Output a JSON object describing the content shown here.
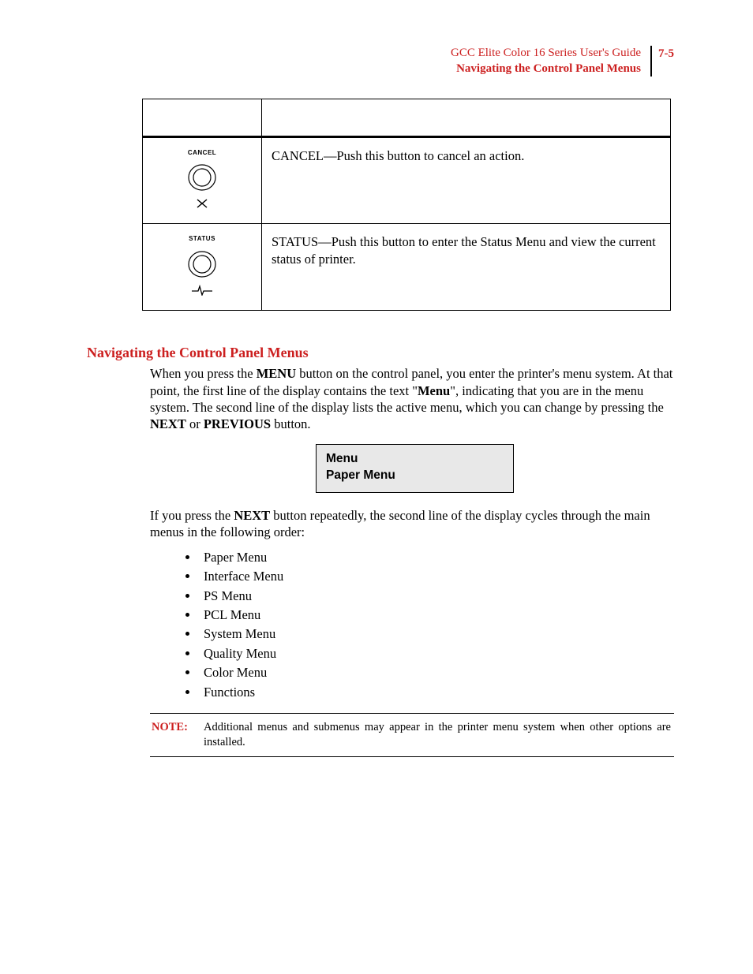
{
  "header": {
    "guide_title": "GCC Elite Color 16 Series User's Guide",
    "section_name": "Navigating the Control Panel Menus",
    "page_number": "7-5"
  },
  "button_table": {
    "rows": [
      {
        "label": "CANCEL",
        "icon": "x",
        "description": "CANCEL—Push this button to cancel an action."
      },
      {
        "label": "STATUS",
        "icon": "pulse",
        "description": "STATUS—Push this button to enter the Status Menu and view the current status of printer."
      }
    ]
  },
  "section": {
    "title": "Navigating the Control Panel Menus",
    "para1_pre": "When you press the ",
    "para1_b1": "MENU",
    "para1_mid1": " button on the control panel, you enter the printer's menu system. At that point, the first line of the display contains the text \"",
    "para1_b2": "Menu",
    "para1_mid2": "\", indicating that you are in the menu system. The second line of the display lists the active menu, which you can change by pressing the ",
    "para1_b3": "NEXT",
    "para1_mid3": " or ",
    "para1_b4": "PREVIOUS",
    "para1_post": " button.",
    "lcd": {
      "line1": "Menu",
      "line2": "Paper Menu"
    },
    "para2_pre": "If you press the ",
    "para2_b1": "NEXT",
    "para2_post": " button repeatedly, the second line of the display cycles through the main menus in the following order:",
    "menus": [
      "Paper Menu",
      "Interface Menu",
      "PS Menu",
      "PCL Menu",
      "System Menu",
      "Quality Menu",
      "Color Menu",
      "Functions"
    ],
    "note": {
      "label": "NOTE:",
      "text": "Additional menus and submenus may appear in the printer menu system when other options are installed."
    }
  }
}
